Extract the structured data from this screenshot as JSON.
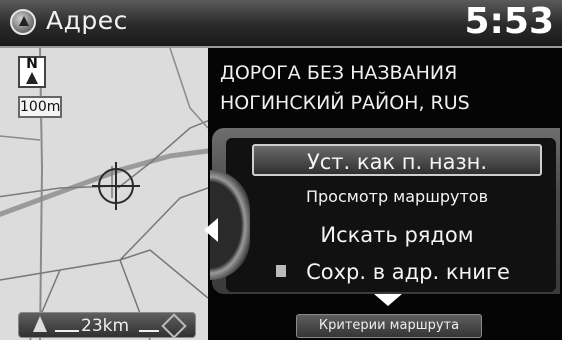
{
  "header": {
    "title": "Адрес",
    "clock": "5:53"
  },
  "map": {
    "north_label": "N",
    "scale_label": "100m",
    "bottom_distance": "23km"
  },
  "address": {
    "line1": "ДОРОГА БЕЗ НАЗВАНИЯ",
    "line2": "НОГИНСКИЙ РАЙОН, RUS"
  },
  "menu": {
    "items": [
      {
        "label": "Уст. как п. назн.",
        "selected": true
      },
      {
        "label": "Просмотр маршрутов"
      },
      {
        "label": "Искать рядом"
      },
      {
        "label": "Сохр. в адр. книге",
        "icon": "address-book-icon"
      }
    ]
  },
  "footer": {
    "criteria_label": "Критерии маршрута"
  }
}
